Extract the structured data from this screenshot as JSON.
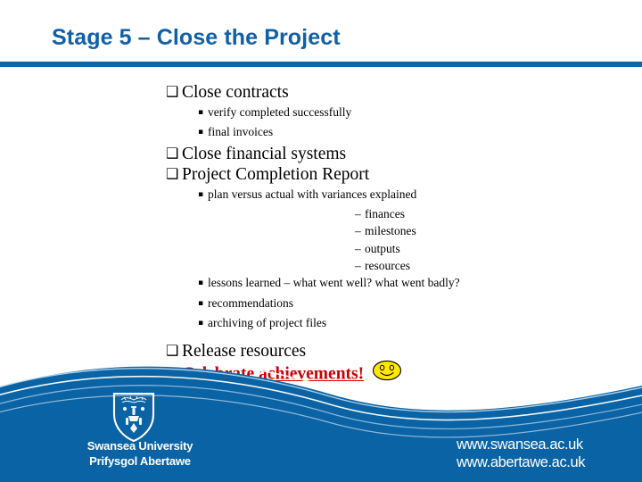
{
  "slide": {
    "title": "Stage 5 – Close the Project",
    "accent_color": "#1060a8",
    "rule_color": "#1166a8",
    "footer_color": "#0a63a4",
    "highlight_color": "#cc0000",
    "smiley_color": "#ffe800"
  },
  "bullets": {
    "b1": {
      "marker": "❑",
      "text": "Close contracts"
    },
    "b2": {
      "marker": "▪",
      "text": "verify completed successfully"
    },
    "b3": {
      "marker": "▪",
      "text": "final invoices"
    },
    "b4": {
      "marker": "❑",
      "text": "Close financial systems"
    },
    "b5": {
      "marker": "❑",
      "text": "Project Completion Report"
    },
    "b6": {
      "marker": "▪",
      "text": "plan versus actual with variances explained"
    },
    "b7": {
      "marker": "–",
      "text": "finances"
    },
    "b8": {
      "marker": "–",
      "text": "milestones"
    },
    "b9": {
      "marker": "–",
      "text": "outputs"
    },
    "b10": {
      "marker": "–",
      "text": "resources"
    },
    "b11": {
      "marker": "▪",
      "text": "lessons learned – what went well? what went badly?"
    },
    "b12": {
      "marker": "▪",
      "text": "recommendations"
    },
    "b13": {
      "marker": "▪",
      "text": "archiving of project files"
    },
    "b14": {
      "marker": "❑",
      "text": "Release resources"
    },
    "b15": {
      "marker": "❑",
      "text": "Celebrate achievements!"
    }
  },
  "footer": {
    "university_en": "Swansea University",
    "university_cy": "Prifysgol Abertawe",
    "url_en": "www.swansea.ac.uk",
    "url_cy": "www.abertawe.ac.uk"
  }
}
